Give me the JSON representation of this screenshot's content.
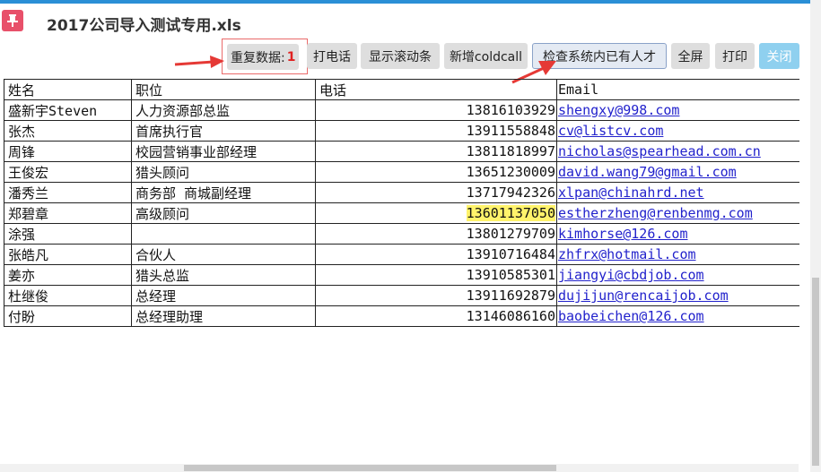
{
  "window": {
    "title": "2017公司导入测试专用.xls"
  },
  "toolbar": {
    "duplicate_label": "重复数据:",
    "duplicate_count": "1",
    "call_label": "打电话",
    "scrollbar_label": "显示滚动条",
    "coldcall_label": "新增coldcall",
    "check_label": "检查系统内已有人才",
    "fullscreen_label": "全屏",
    "print_label": "打印",
    "close_label": "关闭"
  },
  "table": {
    "headers": {
      "name": "姓名",
      "position": "职位",
      "phone": "电话",
      "email": "Email"
    },
    "rows": [
      {
        "name": "盛新宇Steven",
        "position": "人力资源部总监",
        "phone": "13816103929",
        "email": "shengxy@998.com"
      },
      {
        "name": "张杰",
        "position": "首席执行官",
        "phone": "13911558848",
        "email": "cv@listcv.com"
      },
      {
        "name": "周锋",
        "position": "校园营销事业部经理",
        "phone": "13811818997",
        "email": "nicholas@spearhead.com.cn"
      },
      {
        "name": "王俊宏",
        "position": "猎头顾问",
        "phone": "13651230009",
        "email": "david.wang79@gmail.com"
      },
      {
        "name": "潘秀兰",
        "position": "商务部 商城副经理",
        "phone": "13717942326",
        "email": "xlpan@chinahrd.net"
      },
      {
        "name": "郑碧章",
        "position": "高级顾问",
        "phone": "13601137050",
        "email": "estherzheng@renbenmg.com"
      },
      {
        "name": "涂强",
        "position": "",
        "phone": "13801279709",
        "email": "kimhorse@126.com"
      },
      {
        "name": "张皓凡",
        "position": "合伙人",
        "phone": "13910716484",
        "email": "zhfrx@hotmail.com"
      },
      {
        "name": "姜亦",
        "position": "猎头总监",
        "phone": "13910585301",
        "email": "jiangyi@cbdjob.com"
      },
      {
        "name": "杜继俊",
        "position": "总经理",
        "phone": "13911692879",
        "email": "dujijun@rencaijob.com"
      },
      {
        "name": "付盼",
        "position": "总经理助理",
        "phone": "13146086160",
        "email": "baobeichen@126.com"
      }
    ]
  },
  "colors": {
    "accent": "#2a8fd6",
    "pin": "#e8506a",
    "highlight": "#fff36b",
    "arrow": "#e53935",
    "link": "#2222cc"
  },
  "icons": {
    "pin": "pushpin-icon"
  }
}
